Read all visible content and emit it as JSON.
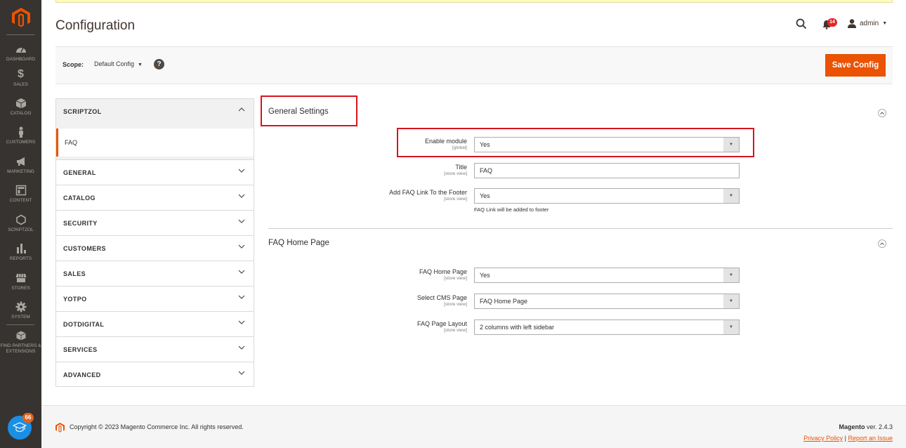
{
  "nav": {
    "items": [
      {
        "label": "DASHBOARD",
        "icon": "dashboard-icon"
      },
      {
        "label": "SALES",
        "icon": "dollar-icon"
      },
      {
        "label": "CATALOG",
        "icon": "box-icon"
      },
      {
        "label": "CUSTOMERS",
        "icon": "person-icon"
      },
      {
        "label": "MARKETING",
        "icon": "megaphone-icon"
      },
      {
        "label": "CONTENT",
        "icon": "layout-icon"
      },
      {
        "label": "SCRIPTZOL",
        "icon": "hexagon-icon"
      },
      {
        "label": "REPORTS",
        "icon": "bar-chart-icon"
      },
      {
        "label": "STORES",
        "icon": "storefront-icon"
      },
      {
        "label": "SYSTEM",
        "icon": "gear-icon"
      },
      {
        "label": "FIND PARTNERS & EXTENSIONS",
        "icon": "extensions-icon"
      }
    ],
    "learn_badge": "66"
  },
  "header": {
    "title": "Configuration",
    "notifications_count": "14",
    "user": "admin"
  },
  "scope": {
    "label": "Scope:",
    "value": "Default Config",
    "help": "?",
    "save_label": "Save Config"
  },
  "tabs": {
    "open_group": "SCRIPTZOL",
    "open_items": [
      "FAQ"
    ],
    "groups": [
      "GENERAL",
      "CATALOG",
      "SECURITY",
      "CUSTOMERS",
      "SALES",
      "YOTPO",
      "DOTDIGITAL",
      "SERVICES",
      "ADVANCED"
    ]
  },
  "sections": {
    "general": {
      "title": "General Settings",
      "fields": [
        {
          "label": "Enable module",
          "scope": "[global]",
          "type": "select",
          "value": "Yes"
        },
        {
          "label": "Title",
          "scope": "[store view]",
          "type": "text",
          "value": "FAQ"
        },
        {
          "label": "Add FAQ Link To the Footer",
          "scope": "[store view]",
          "type": "select",
          "value": "Yes",
          "note": "FAQ Link will be added to footer"
        }
      ]
    },
    "home": {
      "title": "FAQ Home Page",
      "fields": [
        {
          "label": "FAQ Home Page",
          "scope": "[store view]",
          "type": "select",
          "value": "Yes"
        },
        {
          "label": "Select CMS Page",
          "scope": "[store view]",
          "type": "select",
          "value": "FAQ Home Page"
        },
        {
          "label": "FAQ Page Layout",
          "scope": "[store view]",
          "type": "select",
          "value": "2 columns with left sidebar"
        }
      ]
    }
  },
  "footer": {
    "copyright": "Copyright © 2023 Magento Commerce Inc. All rights reserved.",
    "brand": "Magento",
    "version": " ver. 2.4.3",
    "privacy": "Privacy Policy",
    "separator": " | ",
    "report": "Report an Issue"
  },
  "colors": {
    "accent": "#eb5202",
    "nav_bg": "#373330",
    "highlight": "#d8141f"
  }
}
